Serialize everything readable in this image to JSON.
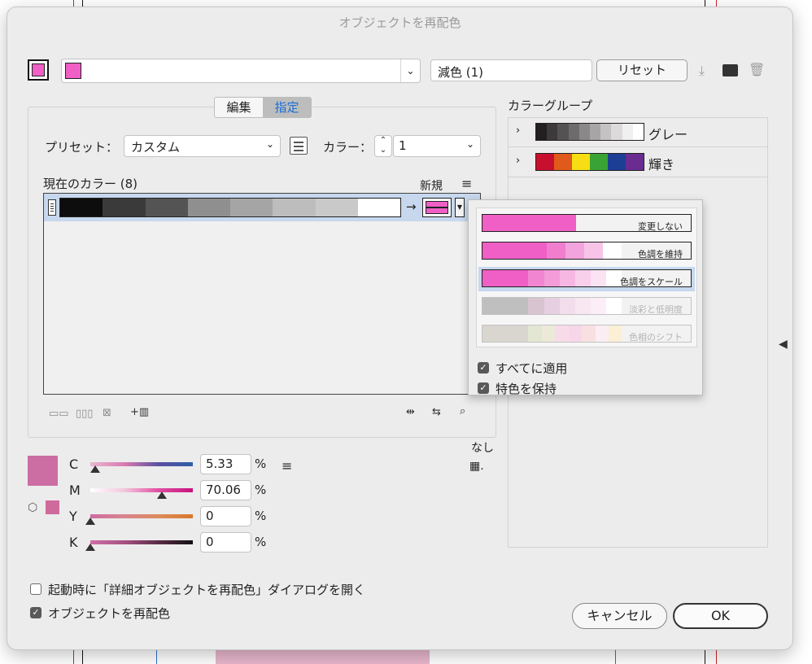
{
  "dialog": {
    "title": "オブジェクトを再配色",
    "reduce_value": "減色 (1)",
    "reset_label": "リセット"
  },
  "tabs": [
    {
      "label": "編集",
      "active": false
    },
    {
      "label": "指定",
      "active": true
    }
  ],
  "preset": {
    "label": "プリセット：",
    "value": "カスタム",
    "color_label": "カラー：",
    "color_count": "1"
  },
  "current_colors": {
    "label": "現在のカラー (8)",
    "new_label": "新規",
    "strip": [
      "#0d0d0d",
      "#3b3a3b",
      "#555454",
      "#8f8f8f",
      "#a5a5a5",
      "#bdbdbd",
      "#c9c9c9",
      "#ffffff"
    ],
    "new_color": "#ef5fc5"
  },
  "cmyk": {
    "swatch_color": "#cc6da3",
    "channels": [
      {
        "label": "C",
        "value": "5.33",
        "pct": "%",
        "level": 0.05
      },
      {
        "label": "M",
        "value": "70.06",
        "pct": "%",
        "level": 0.7
      },
      {
        "label": "Y",
        "value": "0",
        "pct": "%",
        "level": 0
      },
      {
        "label": "K",
        "value": "0",
        "pct": "%",
        "level": 0
      }
    ],
    "none_label": "なし"
  },
  "color_groups": {
    "header": "カラーグループ",
    "groups": [
      {
        "name": "グレー",
        "colors": [
          "#231f20",
          "#3d3a3b",
          "#545253",
          "#6d6b6c",
          "#8a8889",
          "#a7a5a6",
          "#c4c2c3",
          "#dcdadb",
          "#f1f0f0",
          "#ffffff"
        ]
      },
      {
        "name": "輝き",
        "colors": [
          "#c8102e",
          "#e05a1c",
          "#f6dd14",
          "#3aa335",
          "#1c3f95",
          "#6b2c91"
        ]
      }
    ]
  },
  "popover": {
    "options": [
      {
        "label": "変更しない",
        "selected": false,
        "disabled": false,
        "fill": 0.45,
        "colors": [
          "#ef5fc5"
        ]
      },
      {
        "label": "色調を維持",
        "selected": false,
        "disabled": false,
        "colors": [
          "#ef5fc5",
          "#ef5fc5",
          "#f17dcf",
          "#f3a3dd",
          "#f7c4e8",
          "#ffffff"
        ]
      },
      {
        "label": "色調をスケール",
        "selected": true,
        "disabled": false,
        "colors": [
          "#ef5fc5",
          "#f285d1",
          "#f49bd9",
          "#f7b7e3",
          "#f9cfec",
          "#fbe3f3",
          "#ffffff"
        ]
      },
      {
        "label": "淡彩と低明度",
        "selected": false,
        "disabled": true,
        "colors": [
          "#bfbfbf",
          "#d8c4d0",
          "#e5cfe0",
          "#f2ddec",
          "#f8e6f1",
          "#fbeef6",
          "#ffffff"
        ]
      },
      {
        "label": "色相のシフト",
        "selected": false,
        "disabled": true,
        "colors": [
          "#d9d6cf",
          "#e3e6d2",
          "#ece9d8",
          "#f8dbe9",
          "#f8d6ea",
          "#f9e0e0",
          "#fbeef2",
          "#fbefd5"
        ]
      }
    ],
    "apply_all": {
      "label": "すべてに適用",
      "checked": true
    },
    "keep_spot": {
      "label": "特色を保持",
      "checked": true
    }
  },
  "footer": {
    "open_advanced": {
      "label": "起動時に「詳細オブジェクトを再配色」ダイアログを開く",
      "checked": false
    },
    "recolor_art": {
      "label": "オブジェクトを再配色",
      "checked": true
    },
    "cancel_label": "キャンセル",
    "ok_label": "OK"
  }
}
